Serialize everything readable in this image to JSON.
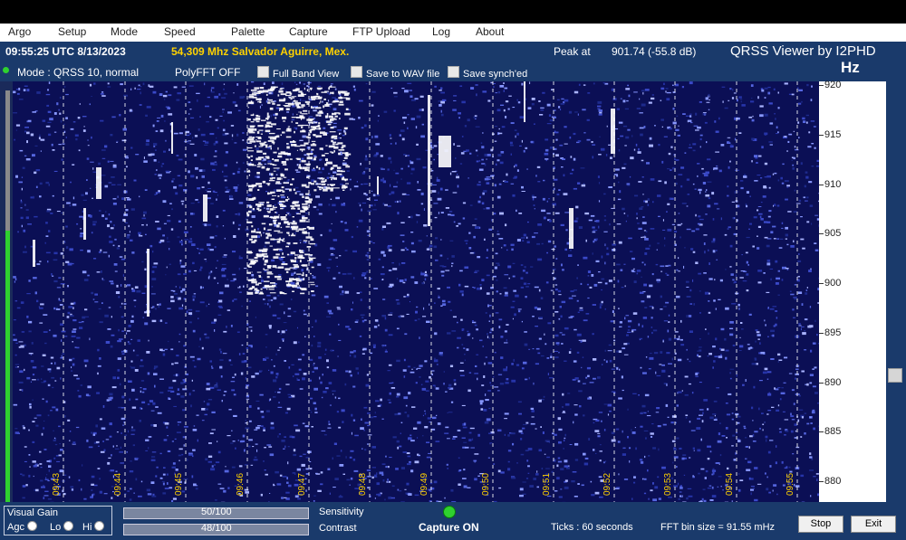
{
  "menu": [
    "Argo",
    "Setup",
    "Mode",
    "Speed",
    "Palette",
    "Capture",
    "FTP Upload",
    "Log",
    "About"
  ],
  "info": {
    "datetime": "09:55:25 UTC  8/13/2023",
    "station": "54,309 Mhz Salvador Aguirre, Mex.",
    "peak_label": "Peak at",
    "peak_value": "901.74 (-55.8 dB)",
    "app_title": "QRSS Viewer by I2PHD",
    "unit": "Hz"
  },
  "controls": {
    "mode": "Mode : QRSS 10, normal",
    "polyfft": "PolyFFT OFF",
    "full_band": "Full Band View",
    "save_wav": "Save to WAV file",
    "save_synch": "Save synch'ed"
  },
  "freq_axis": [
    "920",
    "915",
    "910",
    "905",
    "900",
    "895",
    "890",
    "885",
    "880"
  ],
  "time_axis": [
    "09:43",
    "09:44",
    "09:45",
    "09:46",
    "09:47",
    "09:48",
    "09:49",
    "09:50",
    "09:51",
    "09:52",
    "09:53",
    "09:54",
    "09:55"
  ],
  "bottom": {
    "visual_gain": "Visual Gain",
    "agc": "Agc",
    "lo": "Lo",
    "hi": "Hi",
    "sensitivity_value": "50/100",
    "sensitivity_label": "Sensitivity",
    "contrast_value": "48/100",
    "contrast_label": "Contrast",
    "capture": "Capture ON",
    "ticks": "Ticks  : 60 seconds",
    "fft_bin": "FFT bin size = 91.55 mHz",
    "stop": "Stop",
    "exit": "Exit"
  },
  "colors": {
    "panel": "#1a3a6b",
    "waterfall_bg": "#0b0f55",
    "station_text": "#ffd200",
    "capture_led": "#2fd12f"
  }
}
